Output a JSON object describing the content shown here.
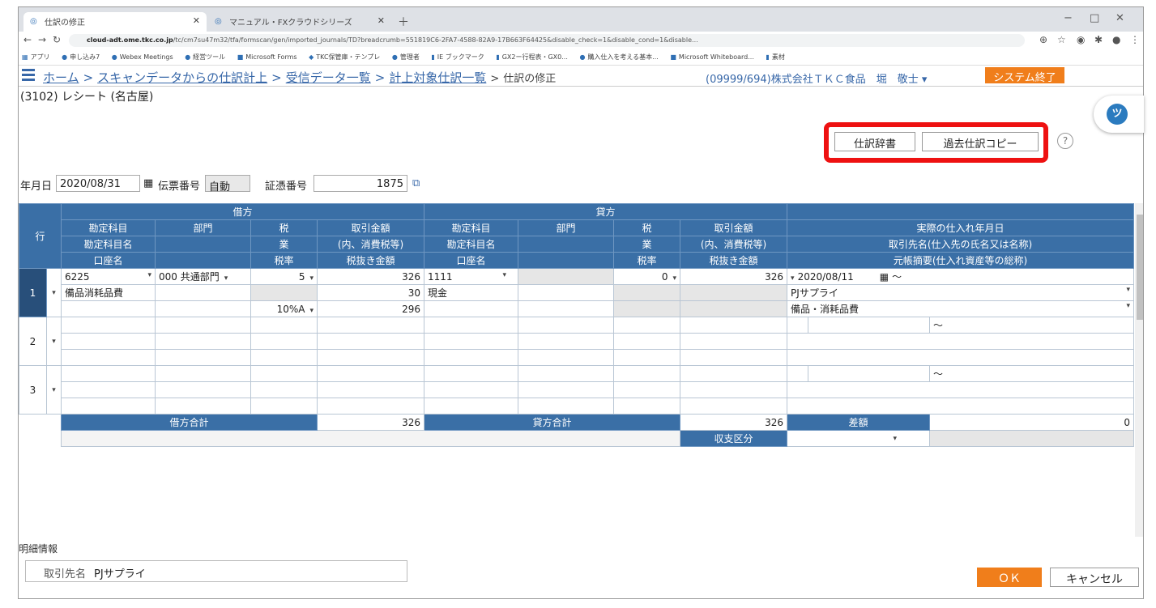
{
  "browser": {
    "tabs": [
      {
        "label": "仕訳の修正"
      },
      {
        "label": "マニュアル・FXクラウドシリーズ"
      }
    ],
    "url_domain": "cloud-adt.ome.tkc.co.jp",
    "url_path": "/tc/cm7su47m32/tfa/formscan/gen/imported_journals/TD?breadcrumb=551819C6-2FA7-4588-82A9-17B663F64425&disable_check=1&disable_cond=1&disable...",
    "bookmarks": [
      "アプリ",
      "申し込み7",
      "Webex Meetings",
      "経営ツール",
      "Microsoft Forms",
      "TKC保管庫・テンプレ",
      "管理者",
      "IE ブックマーク",
      "GX2ー行程表・GX0...",
      "購入仕入を考える基本...",
      "Microsoft Whiteboard...",
      "素材"
    ]
  },
  "header": {
    "breadcrumbs": [
      "ホーム",
      "スキャンデータからの仕訳計上",
      "受信データ一覧",
      "計上対象仕訳一覧"
    ],
    "current": "仕訳の修正",
    "company": "(09999/694)株式会社ＴＫＣ食品　堀　敬士 ▾",
    "exit_button": "システム終了"
  },
  "page": {
    "subtitle": "(3102) レシート (名古屋)",
    "dictionary_button": "仕訳辞書",
    "copy_button": "過去仕訳コピー",
    "help_icon": "?"
  },
  "voucher": {
    "date_label": "年月日",
    "date_value": "2020/08/31",
    "slip_label": "伝票番号",
    "slip_value": "自動",
    "evidence_label": "証憑番号",
    "evidence_value": "1875"
  },
  "table": {
    "row_header": "行",
    "debit_header": "借方",
    "credit_header": "貸方",
    "col_account": [
      "勘定科目",
      "勘定科目名",
      "口座名"
    ],
    "col_dept": "部門",
    "col_tax": [
      "税",
      "業",
      "税率"
    ],
    "col_amount": [
      "取引金額",
      "(内、消費税等)",
      "税抜き金額"
    ],
    "right_header": [
      "実際の仕入れ年月日",
      "取引先名(仕入先の氏名又は名称)",
      "元帳摘要(仕入れ資産等の総称)"
    ],
    "row1": {
      "num": "1",
      "debit_code": "6225",
      "debit_name": "備品消耗品費",
      "debit_dept": "000 共通部門",
      "debit_tax": "5",
      "debit_rate": "10%A",
      "debit_amount": "326",
      "debit_tax_amt": "30",
      "debit_net": "296",
      "credit_code": "1111",
      "credit_name": "現金",
      "credit_tax": "0",
      "credit_amount": "326",
      "purchase_date": "2020/08/11",
      "partner": "PJサプライ",
      "memo": "備品・消耗品費"
    },
    "row2_num": "2",
    "row3_num": "3",
    "tilde": "～",
    "debit_total_label": "借方合計",
    "debit_total": "326",
    "credit_total_label": "貸方合計",
    "credit_total": "326",
    "diff_label": "差額",
    "diff_value": "0",
    "category_label": "収支区分"
  },
  "detail": {
    "section_label": "明細情報",
    "partner_label": "取引先名",
    "partner_value": "PJサプライ"
  },
  "footer": {
    "ok": "ＯＫ",
    "cancel": "キャンセル"
  }
}
